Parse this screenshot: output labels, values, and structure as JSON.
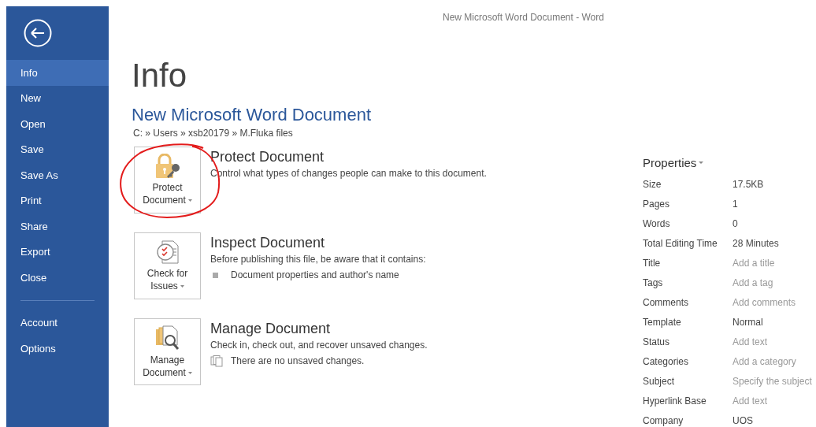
{
  "window": {
    "title": "New Microsoft Word Document - Word"
  },
  "sidebar": {
    "items": [
      {
        "label": "Info",
        "selected": true
      },
      {
        "label": "New",
        "selected": false
      },
      {
        "label": "Open",
        "selected": false
      },
      {
        "label": "Save",
        "selected": false
      },
      {
        "label": "Save As",
        "selected": false
      },
      {
        "label": "Print",
        "selected": false
      },
      {
        "label": "Share",
        "selected": false
      },
      {
        "label": "Export",
        "selected": false
      },
      {
        "label": "Close",
        "selected": false
      }
    ],
    "bottom_items": [
      {
        "label": "Account",
        "selected": false
      },
      {
        "label": "Options",
        "selected": false
      }
    ]
  },
  "page_title": "Info",
  "document": {
    "name": "New Microsoft Word Document",
    "path": "C: » Users » xsb20179 » M.Fluka files"
  },
  "sections": [
    {
      "kind": "protect",
      "button_lines": [
        "Protect",
        "Document"
      ],
      "heading": "Protect Document",
      "description": "Control what types of changes people can make to this document.",
      "circled": true
    },
    {
      "kind": "inspect",
      "button_lines": [
        "Check for",
        "Issues"
      ],
      "heading": "Inspect Document",
      "description": "Before publishing this file, be aware that it contains:",
      "circled": false,
      "items": [
        {
          "kind": "bullet",
          "text": "Document properties and author's name"
        }
      ]
    },
    {
      "kind": "manage",
      "button_lines": [
        "Manage",
        "Document"
      ],
      "heading": "Manage Document",
      "description": "Check in, check out, and recover unsaved changes.",
      "circled": false,
      "items": [
        {
          "kind": "versions",
          "text": "There are no unsaved changes."
        }
      ]
    }
  ],
  "properties": {
    "heading": "Properties",
    "rows": [
      {
        "label": "Size",
        "value": "17.5KB"
      },
      {
        "label": "Pages",
        "value": "1"
      },
      {
        "label": "Words",
        "value": "0"
      },
      {
        "label": "Total Editing Time",
        "value": "28 Minutes"
      },
      {
        "label": "Title",
        "placeholder": "Add a title"
      },
      {
        "label": "Tags",
        "placeholder": "Add a tag"
      },
      {
        "label": "Comments",
        "placeholder": "Add comments"
      },
      {
        "label": "Template",
        "value": "Normal"
      },
      {
        "label": "Status",
        "placeholder": "Add text"
      },
      {
        "label": "Categories",
        "placeholder": "Add a category"
      },
      {
        "label": "Subject",
        "placeholder": "Specify the subject"
      },
      {
        "label": "Hyperlink Base",
        "placeholder": "Add text"
      },
      {
        "label": "Company",
        "value": "UOS"
      }
    ]
  }
}
